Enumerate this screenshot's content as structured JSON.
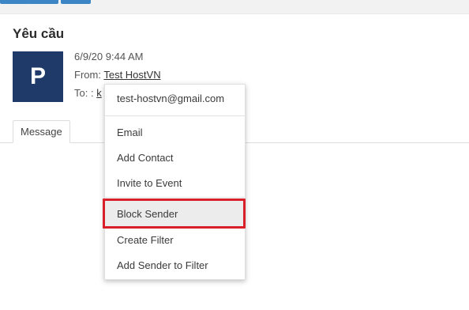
{
  "email": {
    "subject": "Yêu cầu",
    "avatar_letter": "P",
    "date": "6/9/20 9:44 AM",
    "from_label": "From:",
    "from_name": "Test HostVN",
    "to_label": "To: :",
    "to_value": "k"
  },
  "tabs": [
    {
      "label": "Message"
    }
  ],
  "context_menu": {
    "header": "test-hostvn@gmail.com",
    "items": [
      {
        "label": "Email"
      },
      {
        "label": "Add Contact"
      },
      {
        "label": "Invite to Event"
      },
      {
        "label": "Block Sender",
        "highlighted": true
      },
      {
        "label": "Create Filter"
      },
      {
        "label": "Add Sender to Filter"
      }
    ]
  },
  "colors": {
    "avatar_bg": "#1f3a68",
    "highlight_border": "#d9202a",
    "toolbar_button": "#3d86c6"
  }
}
